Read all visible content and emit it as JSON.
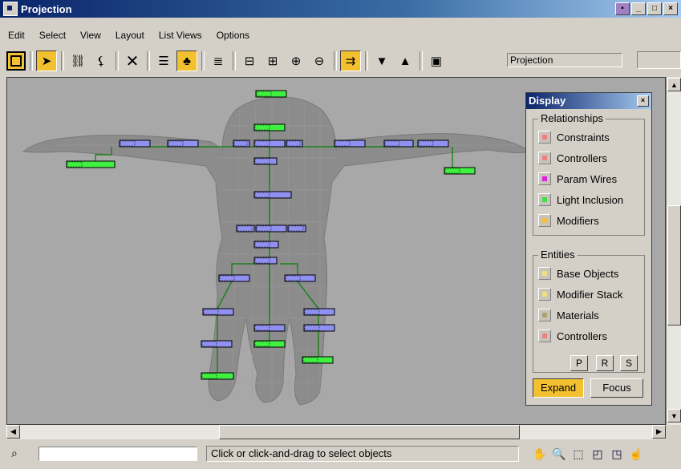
{
  "window": {
    "title": "Projection"
  },
  "menu": [
    "Edit",
    "Select",
    "View",
    "Layout",
    "List Views",
    "Options"
  ],
  "toolbar": {
    "name_field": "Projection"
  },
  "display_panel": {
    "title": "Display",
    "relationships": {
      "label": "Relationships",
      "items": [
        {
          "label": "Constraints",
          "color": "#f08080"
        },
        {
          "label": "Controllers",
          "color": "#f08080"
        },
        {
          "label": "Param Wires",
          "color": "#e020e0"
        },
        {
          "label": "Light Inclusion",
          "color": "#40e040"
        },
        {
          "label": "Modifiers",
          "color": "#f0c040"
        }
      ]
    },
    "entities": {
      "label": "Entities",
      "items": [
        {
          "label": "Base Objects",
          "color": "#f0e080"
        },
        {
          "label": "Modifier Stack",
          "color": "#f0e080"
        },
        {
          "label": "Materials",
          "color": "#b0a070"
        },
        {
          "label": "Controllers",
          "color": "#f08080"
        }
      ],
      "buttons": [
        "P",
        "R",
        "S"
      ]
    },
    "expand_label": "Expand",
    "focus_label": "Focus"
  },
  "status": {
    "prompt": "Click or click-and-drag to select objects"
  },
  "colors": {
    "node_bone": "#9090f0",
    "node_ik": "#40f040",
    "wire": "#008000",
    "viewport_bg": "#a8a8a8"
  }
}
